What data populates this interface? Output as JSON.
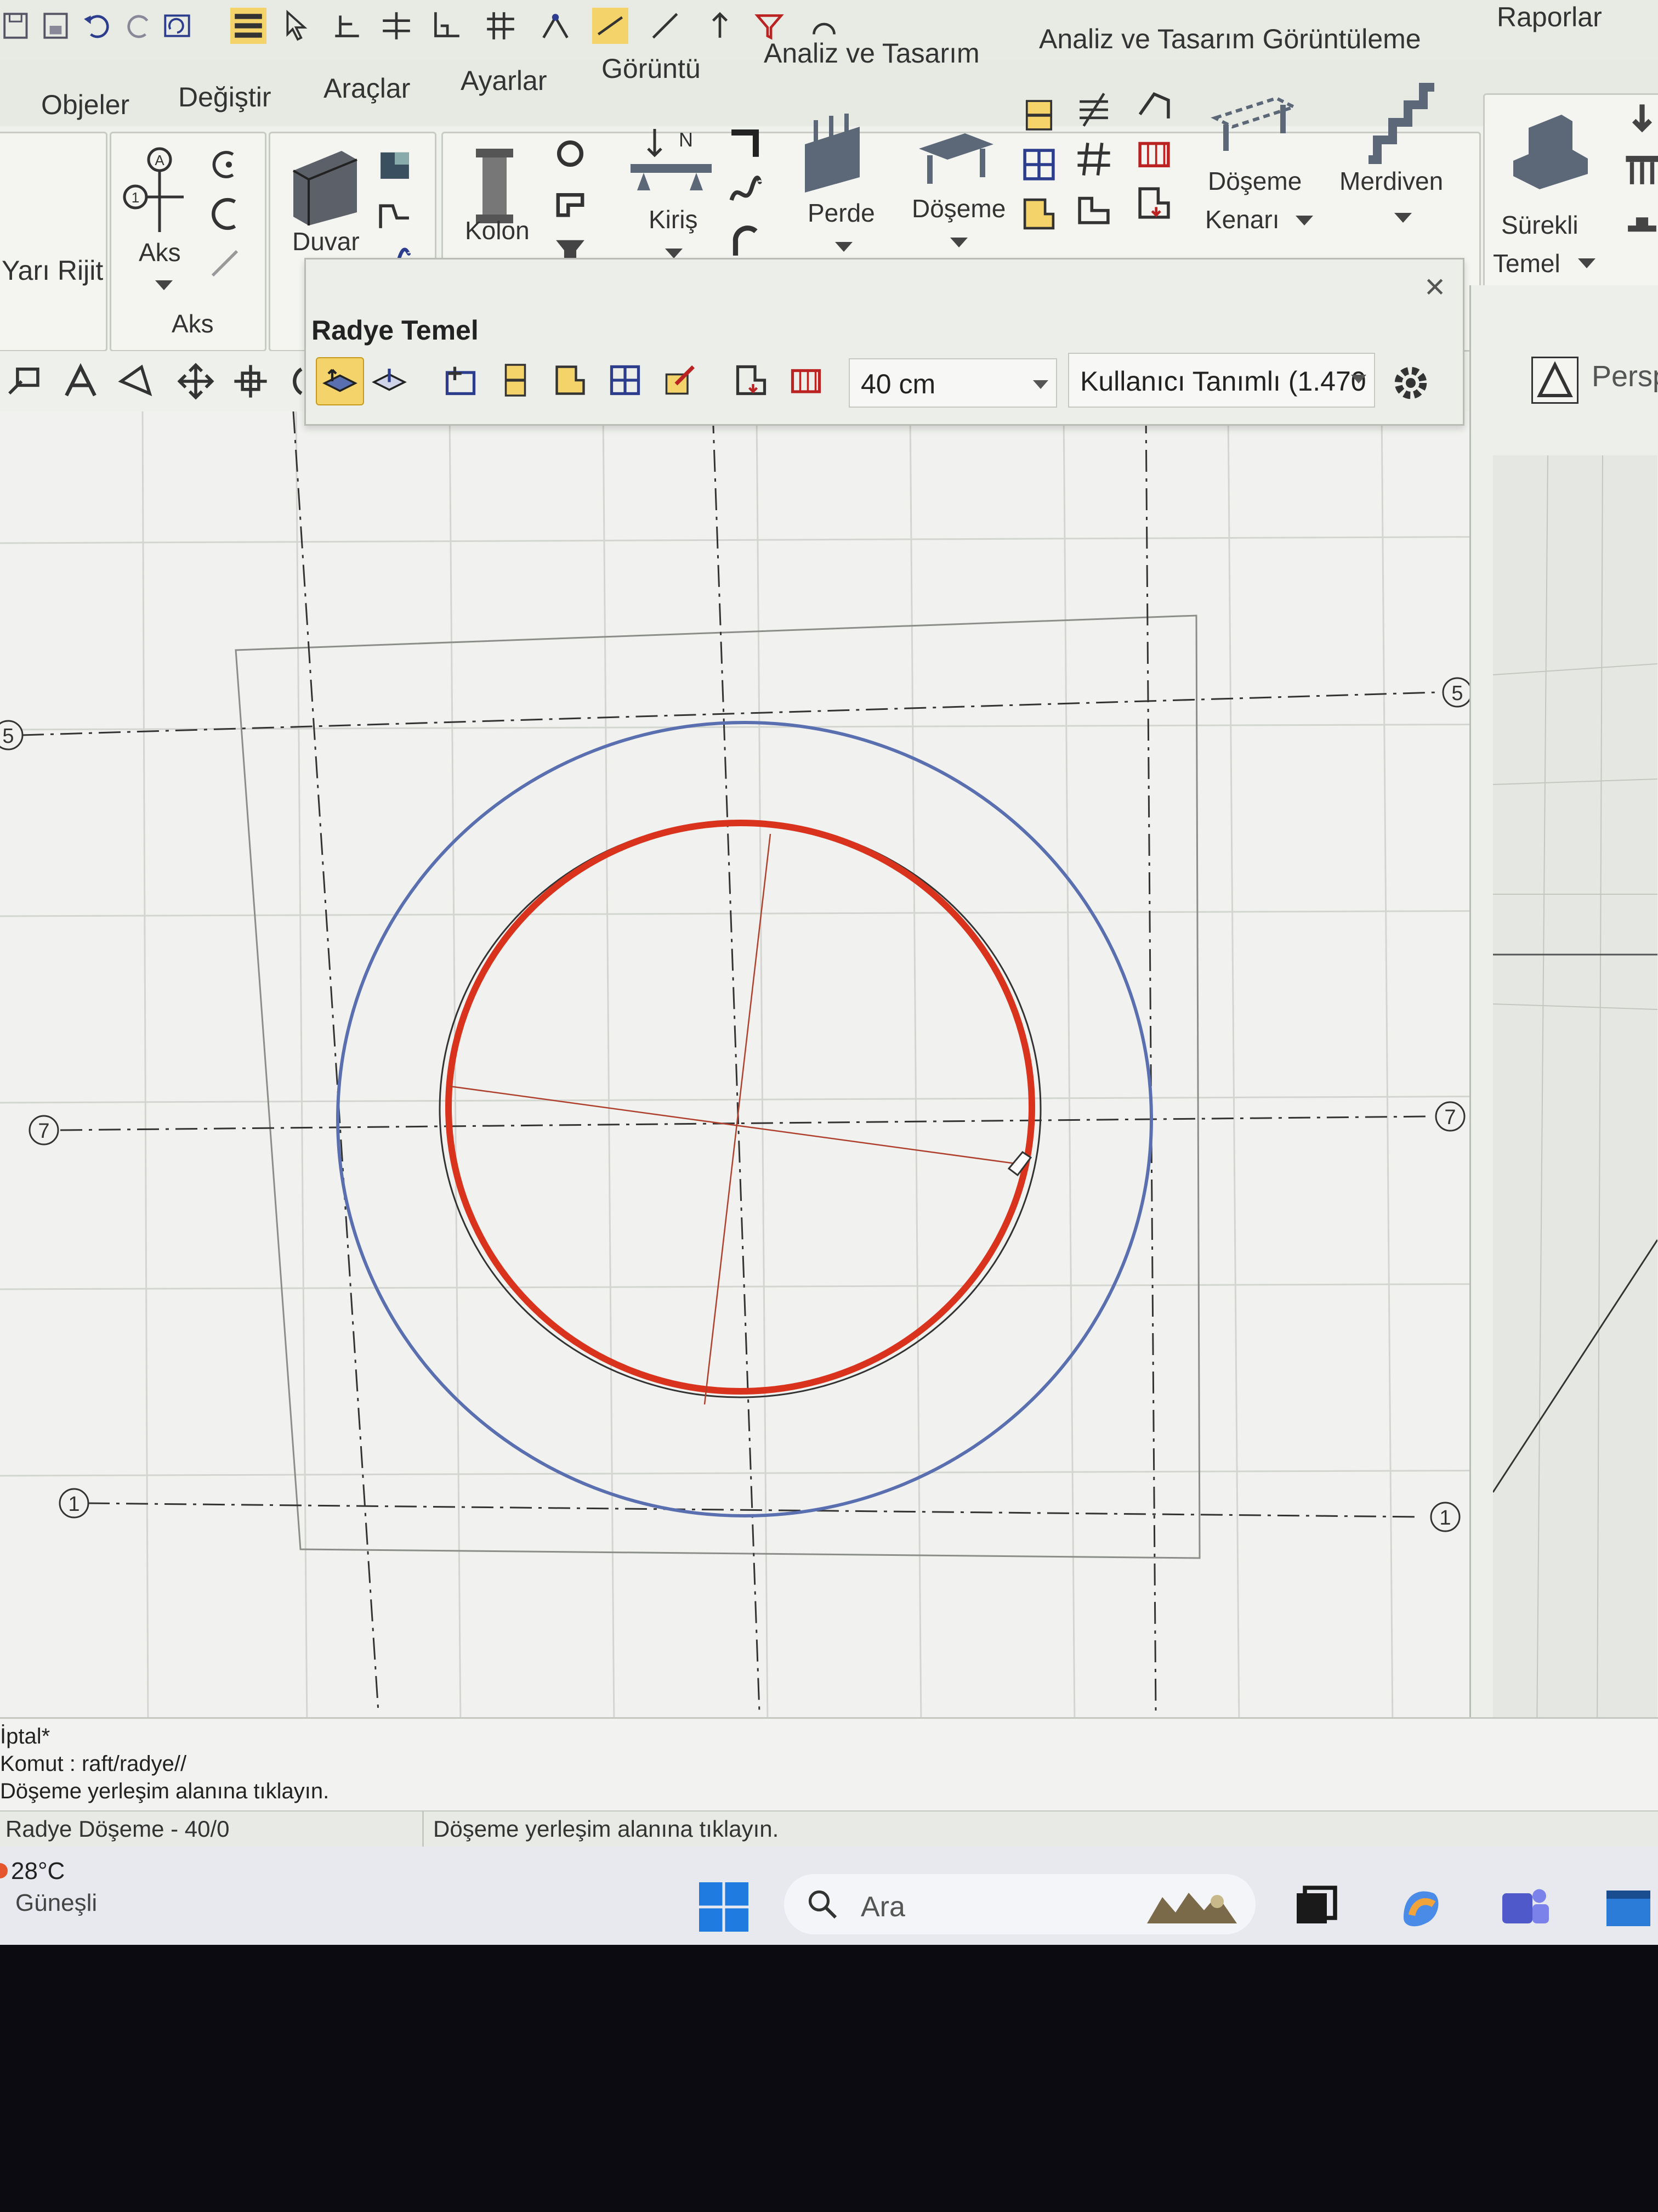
{
  "menu": {
    "tabs": [
      "Objeler",
      "Değiştir",
      "Araçlar",
      "Ayarlar",
      "Görüntü",
      "Analiz ve Tasarım",
      "Analiz ve Tasarım Görüntüleme",
      "Raporlar"
    ]
  },
  "ribbon": {
    "partial_left_label": "Yarı Rijit",
    "aks_group_label": "Aks",
    "aks_button": "Aks",
    "duvar": "Duvar",
    "kolon": "Kolon",
    "kiris": "Kiriş",
    "kiris_north": "N",
    "perde": "Perde",
    "doseme": "Döşeme",
    "doseme_kenari_1": "Döşeme",
    "doseme_kenari_2": "Kenarı",
    "merdiven": "Merdiven",
    "surekli_1": "Sürekli",
    "surekli_2": "Temel",
    "aks_circle": "A",
    "aks_num": "1"
  },
  "panel": {
    "title": "Radye Temel",
    "thickness": "40 cm",
    "type": "Kullanıcı Tanımlı (1.470",
    "close": "×"
  },
  "view": {
    "persp_label": "Persp"
  },
  "drawing": {
    "axis_labels": [
      "5",
      "7",
      "1"
    ]
  },
  "command": {
    "lines": [
      "İptal*",
      "Komut : raft/radye//",
      "Döşeme yerleşim alanına tıklayın."
    ]
  },
  "status": {
    "left": "Radye Döşeme - 40/0",
    "right": "Döşeme yerleşim alanına tıklayın."
  },
  "taskbar": {
    "temperature": "28°C",
    "weather": "Güneşli",
    "search_placeholder": "Ara"
  },
  "colors": {
    "accent_red": "#d9331e",
    "outline_blue": "#5a6fb0",
    "axis_line": "#333333"
  }
}
